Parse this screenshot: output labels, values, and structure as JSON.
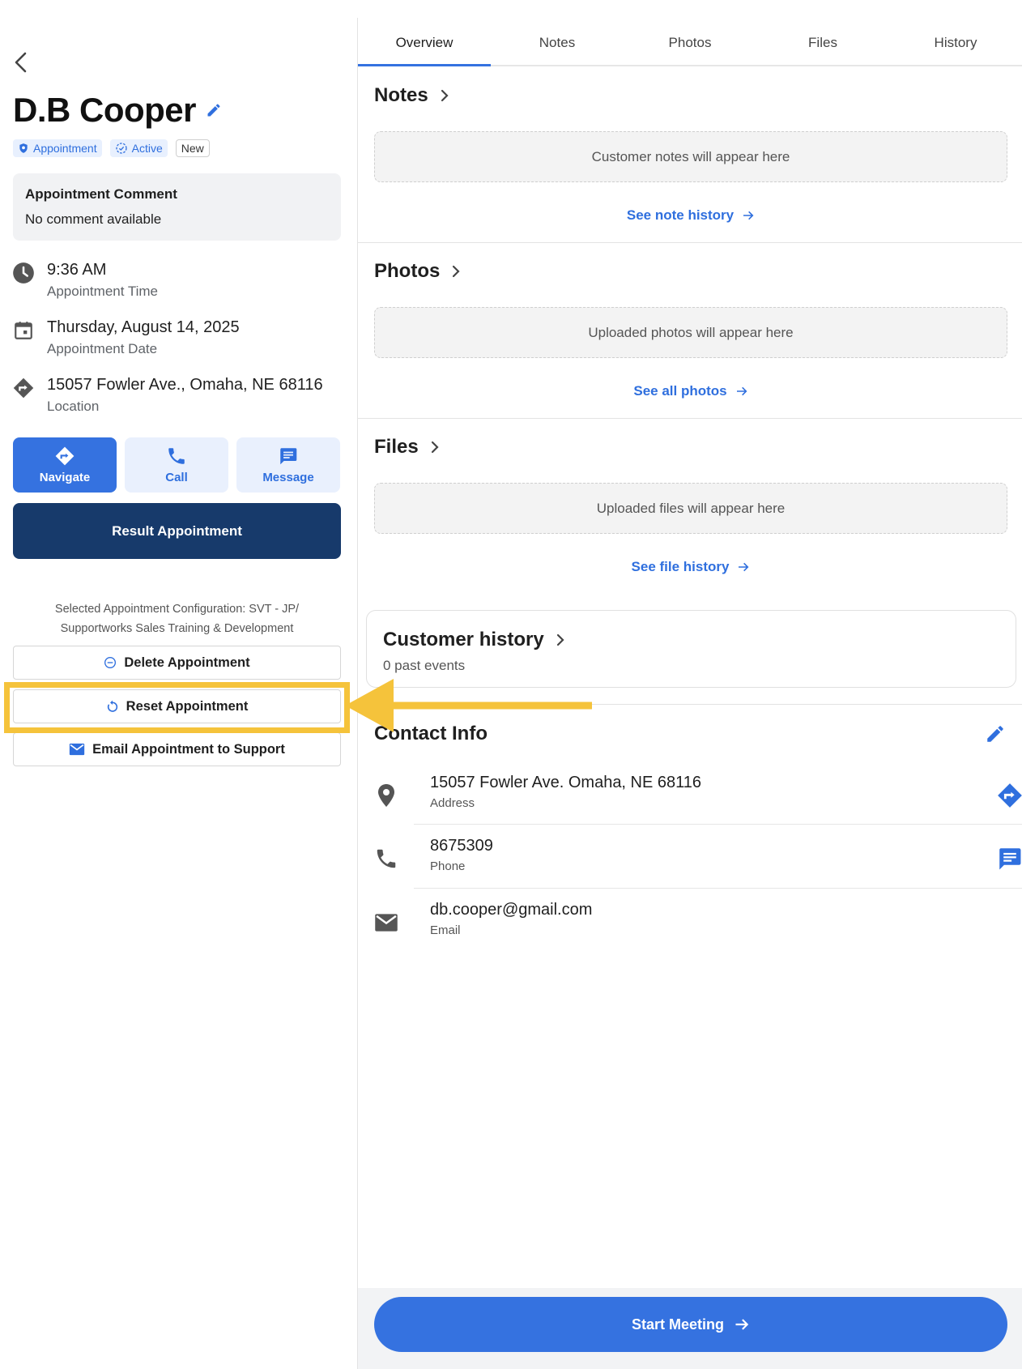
{
  "customer": {
    "name": "D.B Cooper",
    "badges": {
      "type": "Appointment",
      "status": "Active",
      "tag": "New"
    }
  },
  "comment": {
    "title": "Appointment Comment",
    "text": "No comment available"
  },
  "appointment": {
    "time": "9:36 AM",
    "time_label": "Appointment Time",
    "date": "Thursday, August 14, 2025",
    "date_label": "Appointment Date",
    "location": "15057 Fowler Ave., Omaha, NE 68116",
    "location_label": "Location"
  },
  "actions": {
    "navigate": "Navigate",
    "call": "Call",
    "message": "Message",
    "result": "Result Appointment"
  },
  "config": {
    "line1": "Selected Appointment Configuration: SVT - JP/",
    "line2": "Supportworks Sales Training & Development"
  },
  "buttons": {
    "delete": "Delete Appointment",
    "reset": "Reset Appointment",
    "email": "Email Appointment to Support"
  },
  "tabs": [
    "Overview",
    "Notes",
    "Photos",
    "Files",
    "History"
  ],
  "sections": {
    "notes": {
      "title": "Notes",
      "placeholder": "Customer notes will appear here",
      "link": "See note history"
    },
    "photos": {
      "title": "Photos",
      "placeholder": "Uploaded photos will appear here",
      "link": "See all photos"
    },
    "files": {
      "title": "Files",
      "placeholder": "Uploaded files will appear here",
      "link": "See file history"
    }
  },
  "history": {
    "title": "Customer history",
    "sub": "0 past events"
  },
  "contact": {
    "title": "Contact Info",
    "address": "15057 Fowler Ave.  Omaha, NE 68116",
    "address_label": "Address",
    "phone": "8675309",
    "phone_label": "Phone",
    "email": "db.cooper@gmail.com",
    "email_label": "Email"
  },
  "start_meeting": "Start Meeting",
  "colors": {
    "accent": "#3572e0",
    "navy": "#173a6b",
    "highlight": "#f5c33b"
  }
}
